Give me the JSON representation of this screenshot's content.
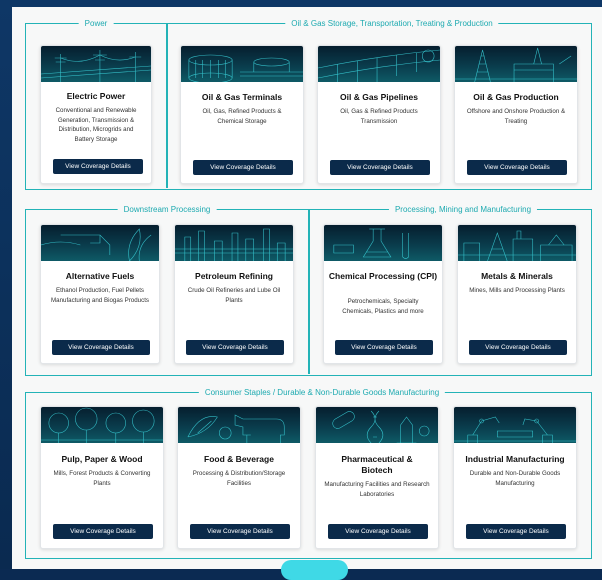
{
  "groups": {
    "power": "Power",
    "oilgas": "Oil & Gas Storage, Transportation, Treating & Production",
    "downstream": "Downstream Processing",
    "processing": "Processing, Mining and Manufacturing",
    "consumer": "Consumer Staples / Durable & Non-Durable Goods Manufacturing"
  },
  "button_label": "View Coverage Details",
  "cards": [
    {
      "title": "Electric Power",
      "desc": "Conventional and Renewable Generation, Transmission & Distribution, Microgrids and Battery Storage",
      "icon": "power-lines-icon"
    },
    {
      "title": "Oil & Gas Terminals",
      "desc": "Oil, Gas, Refined Products & Chemical Storage",
      "icon": "storage-tank-icon"
    },
    {
      "title": "Oil & Gas Pipelines",
      "desc": "Oil, Gas & Refined Products Transmission",
      "icon": "pipeline-icon"
    },
    {
      "title": "Oil & Gas Production",
      "desc": "Offshore and Onshore Production & Treating",
      "icon": "oil-rig-icon"
    },
    {
      "title": "Alternative Fuels",
      "desc": "Ethanol Production, Fuel Pellets Manufacturing and Biogas Products",
      "icon": "fuel-nozzle-icon"
    },
    {
      "title": "Petroleum Refining",
      "desc": "Crude Oil Refineries and Lube Oil Plants",
      "icon": "refinery-icon"
    },
    {
      "title": "Chemical Processing (CPI)",
      "desc": "Petrochemicals, Specialty Chemicals, Plastics and more",
      "icon": "flask-icon"
    },
    {
      "title": "Metals & Minerals",
      "desc": "Mines, Mills and Processing Plants",
      "icon": "mining-plant-icon"
    },
    {
      "title": "Pulp, Paper & Wood",
      "desc": "Mills, Forest Products & Converting Plants",
      "icon": "trees-icon"
    },
    {
      "title": "Food & Beverage",
      "desc": "Processing & Distribution/Storage Facilities",
      "icon": "cow-icon"
    },
    {
      "title": "Pharmaceutical & Biotech",
      "desc": "Manufacturing Facilities and Research Laboratories",
      "icon": "pills-icon"
    },
    {
      "title": "Industrial Manufacturing",
      "desc": "Durable and Non-Durable Goods Manufacturing",
      "icon": "robot-arm-icon"
    }
  ]
}
